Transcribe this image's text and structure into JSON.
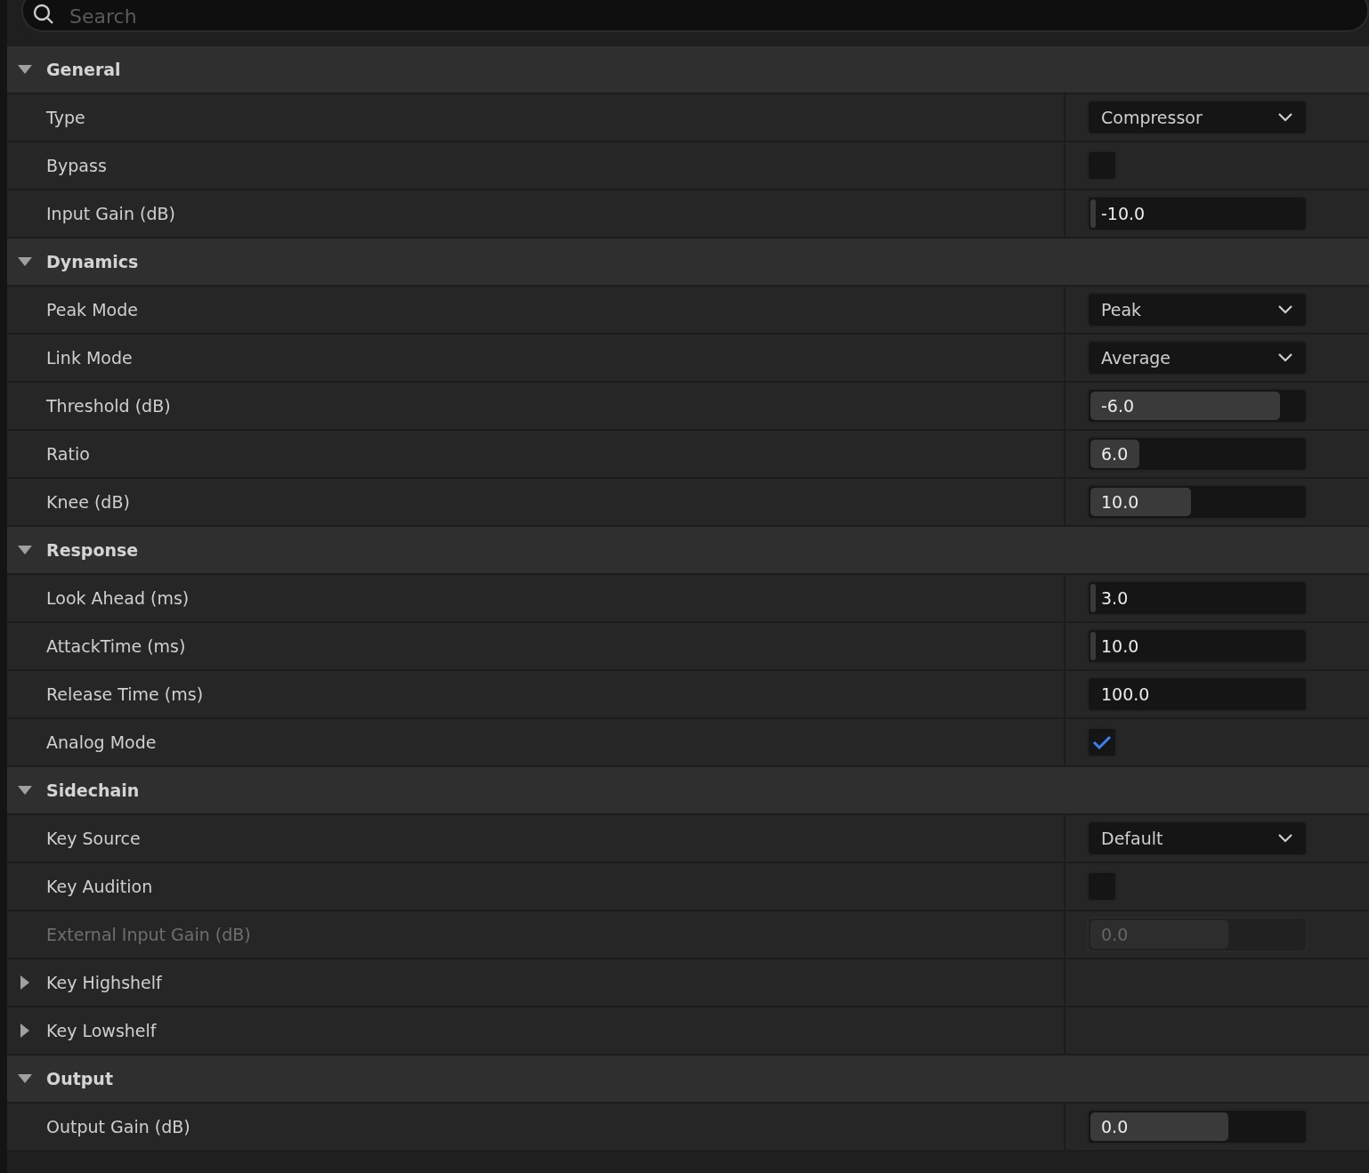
{
  "search": {
    "placeholder": "Search"
  },
  "sections": [
    {
      "title": "General",
      "expanded": true,
      "rows": [
        {
          "kind": "dropdown",
          "label": "Type",
          "value": "Compressor"
        },
        {
          "kind": "checkbox",
          "label": "Bypass",
          "checked": false
        },
        {
          "kind": "number",
          "label": "Input Gain (dB)",
          "value": "-10.0",
          "level": 0.02
        }
      ]
    },
    {
      "title": "Dynamics",
      "expanded": true,
      "rows": [
        {
          "kind": "dropdown",
          "label": "Peak Mode",
          "value": "Peak"
        },
        {
          "kind": "dropdown",
          "label": "Link Mode",
          "value": "Average"
        },
        {
          "kind": "number",
          "label": "Threshold (dB)",
          "value": "-6.0",
          "level": 0.89
        },
        {
          "kind": "number",
          "label": "Ratio",
          "value": "6.0",
          "level": 0.24
        },
        {
          "kind": "number",
          "label": "Knee (dB)",
          "value": "10.0",
          "level": 0.48
        }
      ]
    },
    {
      "title": "Response",
      "expanded": true,
      "rows": [
        {
          "kind": "number",
          "label": "Look Ahead (ms)",
          "value": "3.0",
          "level": 0.02
        },
        {
          "kind": "number",
          "label": "AttackTime (ms)",
          "value": "10.0",
          "level": 0.01
        },
        {
          "kind": "field",
          "label": "Release Time (ms)",
          "value": "100.0"
        },
        {
          "kind": "checkbox",
          "label": "Analog Mode",
          "checked": true
        }
      ]
    },
    {
      "title": "Sidechain",
      "expanded": true,
      "rows": [
        {
          "kind": "dropdown",
          "label": "Key Source",
          "value": "Default"
        },
        {
          "kind": "checkbox",
          "label": "Key Audition",
          "checked": false
        },
        {
          "kind": "number",
          "label": "External Input Gain (dB)",
          "value": "0.0",
          "level": 0.65,
          "disabled": true
        },
        {
          "kind": "group",
          "label": "Key Highshelf",
          "expanded": false
        },
        {
          "kind": "group",
          "label": "Key Lowshelf",
          "expanded": false
        }
      ]
    },
    {
      "title": "Output",
      "expanded": true,
      "rows": [
        {
          "kind": "number",
          "label": "Output Gain (dB)",
          "value": "0.0",
          "level": 0.65
        }
      ]
    }
  ]
}
